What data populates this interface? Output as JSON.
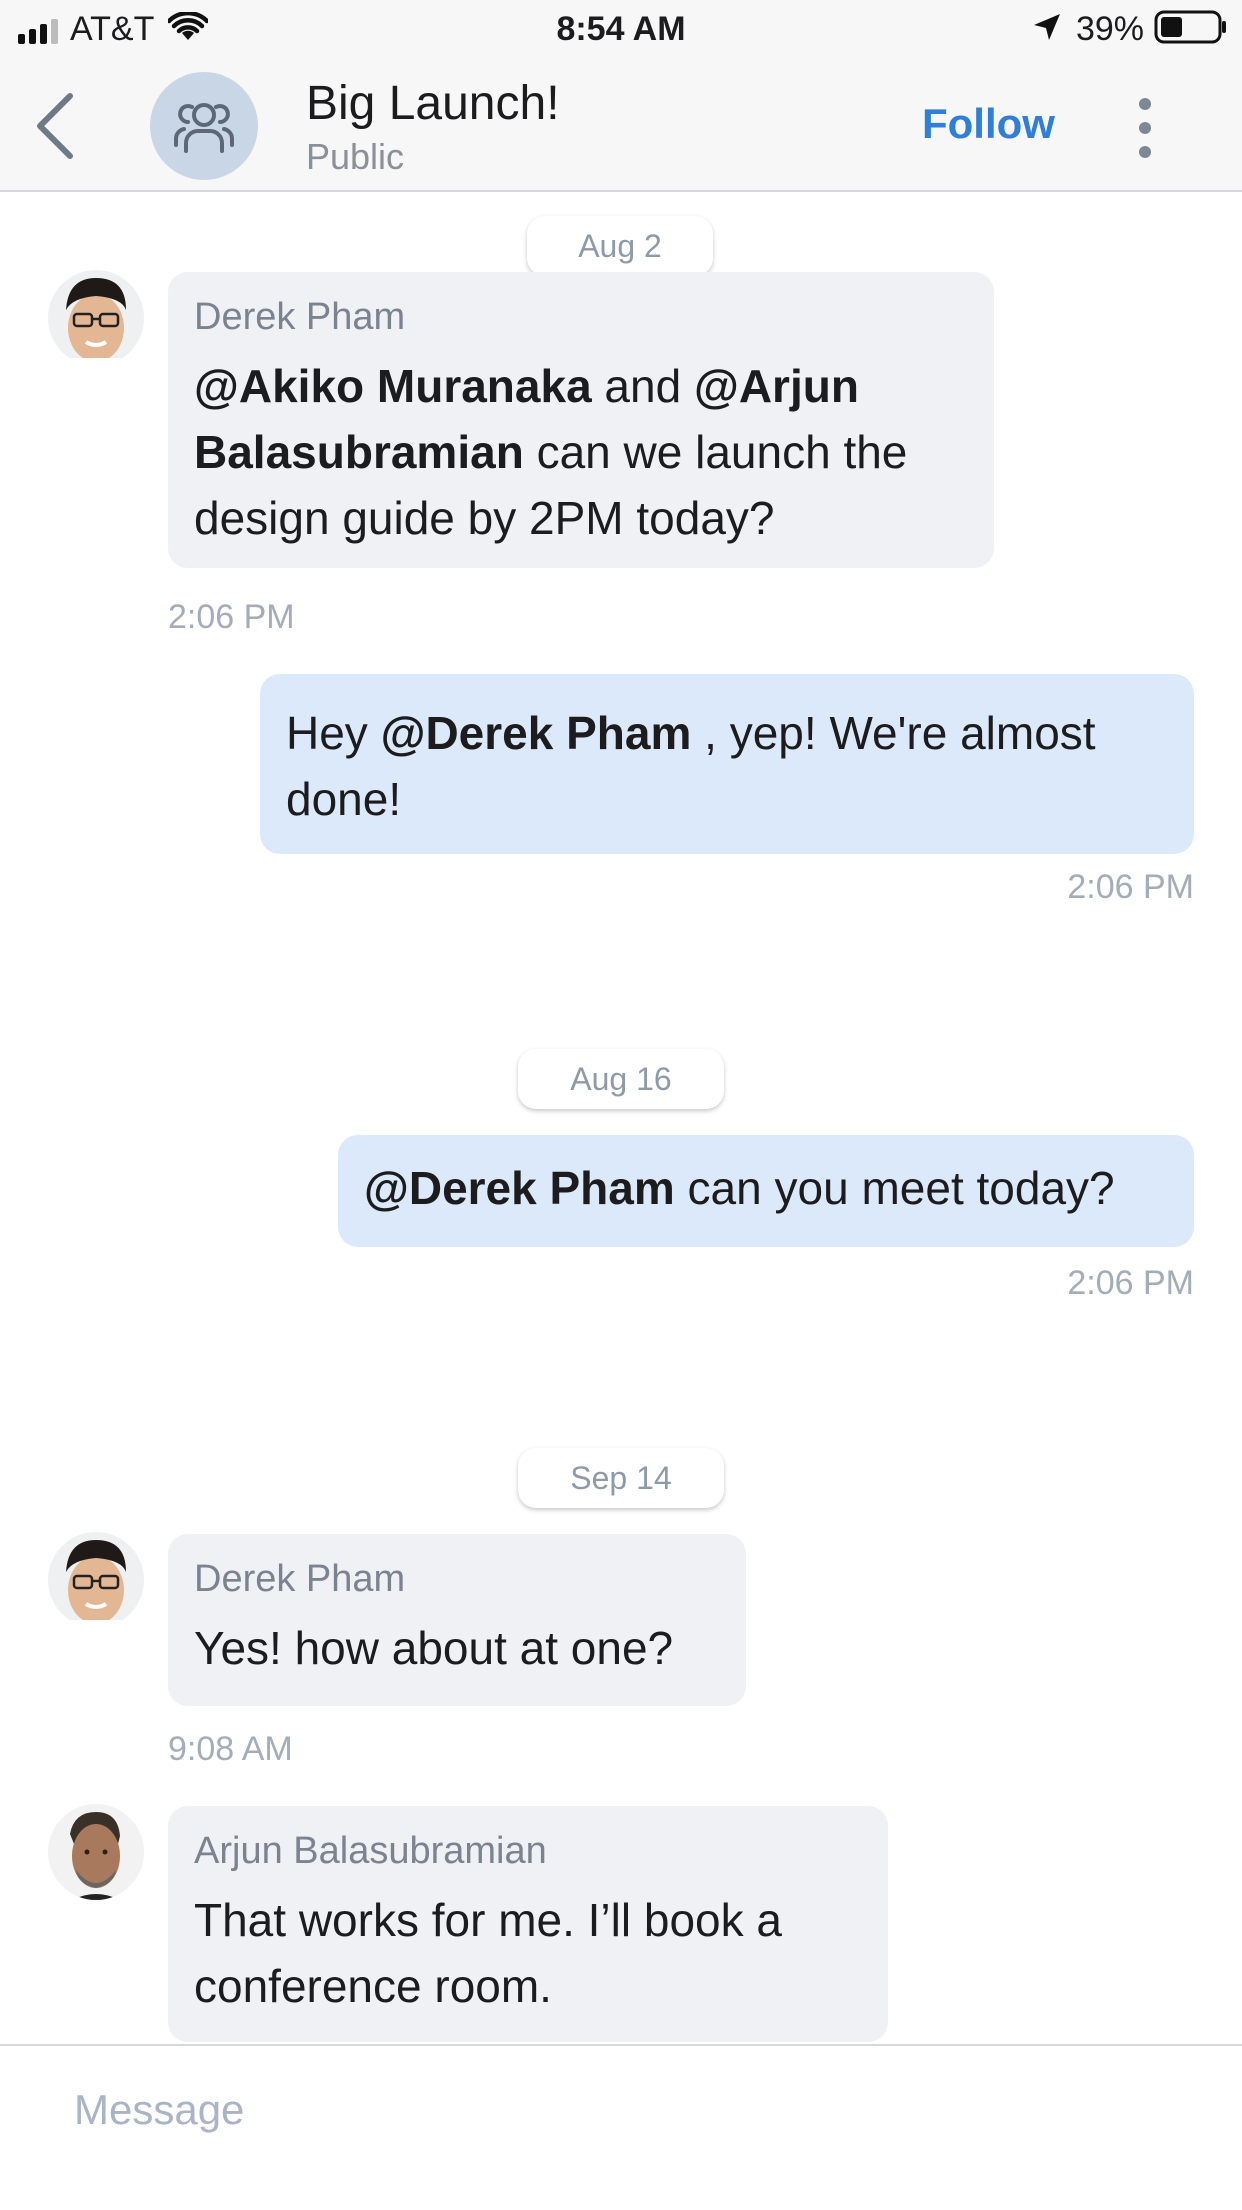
{
  "status_bar": {
    "carrier": "AT&T",
    "time": "8:54 AM",
    "battery": "39%",
    "battery_level": 0.39,
    "signal_bars_filled": 3
  },
  "header": {
    "title": "Big Launch!",
    "subtitle": "Public",
    "follow_label": "Follow",
    "back_icon": "chevron-left-icon",
    "group_icon": "group-icon",
    "more_icon": "more-vertical-icon"
  },
  "dates": [
    "Aug 2",
    "Aug 16",
    "Sep 14"
  ],
  "messages": [
    {
      "sender": "Derek Pham",
      "parts": [
        {
          "text": "@Akiko Muranaka",
          "mention": true
        },
        {
          "text": " and ",
          "mention": false
        },
        {
          "text": "@Arjun Balasubramian",
          "mention": true
        },
        {
          "text": " can we launch the design guide by 2PM today?",
          "mention": false
        }
      ],
      "time": "2:06 PM",
      "outgoing": false
    },
    {
      "sender": "",
      "parts": [
        {
          "text": "Hey ",
          "mention": false
        },
        {
          "text": "@Derek Pham",
          "mention": true
        },
        {
          "text": " , yep! We're almost done!",
          "mention": false
        }
      ],
      "time": "2:06 PM",
      "outgoing": true
    },
    {
      "sender": "",
      "parts": [
        {
          "text": "@Derek Pham",
          "mention": true
        },
        {
          "text": " can you meet today?",
          "mention": false
        }
      ],
      "time": "2:06 PM",
      "outgoing": true
    },
    {
      "sender": "Derek Pham",
      "parts": [
        {
          "text": "Yes! how about at one?",
          "mention": false
        }
      ],
      "time": "9:08 AM",
      "outgoing": false
    },
    {
      "sender": "Arjun Balasubramian",
      "parts": [
        {
          "text": "That works for me. I’ll book a conference room.",
          "mention": false
        }
      ],
      "time": "",
      "outgoing": false
    }
  ],
  "composer": {
    "placeholder": "Message",
    "value": ""
  },
  "colors": {
    "accent": "#2f7ed8",
    "incoming_bubble": "#eff1f5",
    "outgoing_bubble": "#dce9fb",
    "timestamp": "#a3acb8"
  }
}
